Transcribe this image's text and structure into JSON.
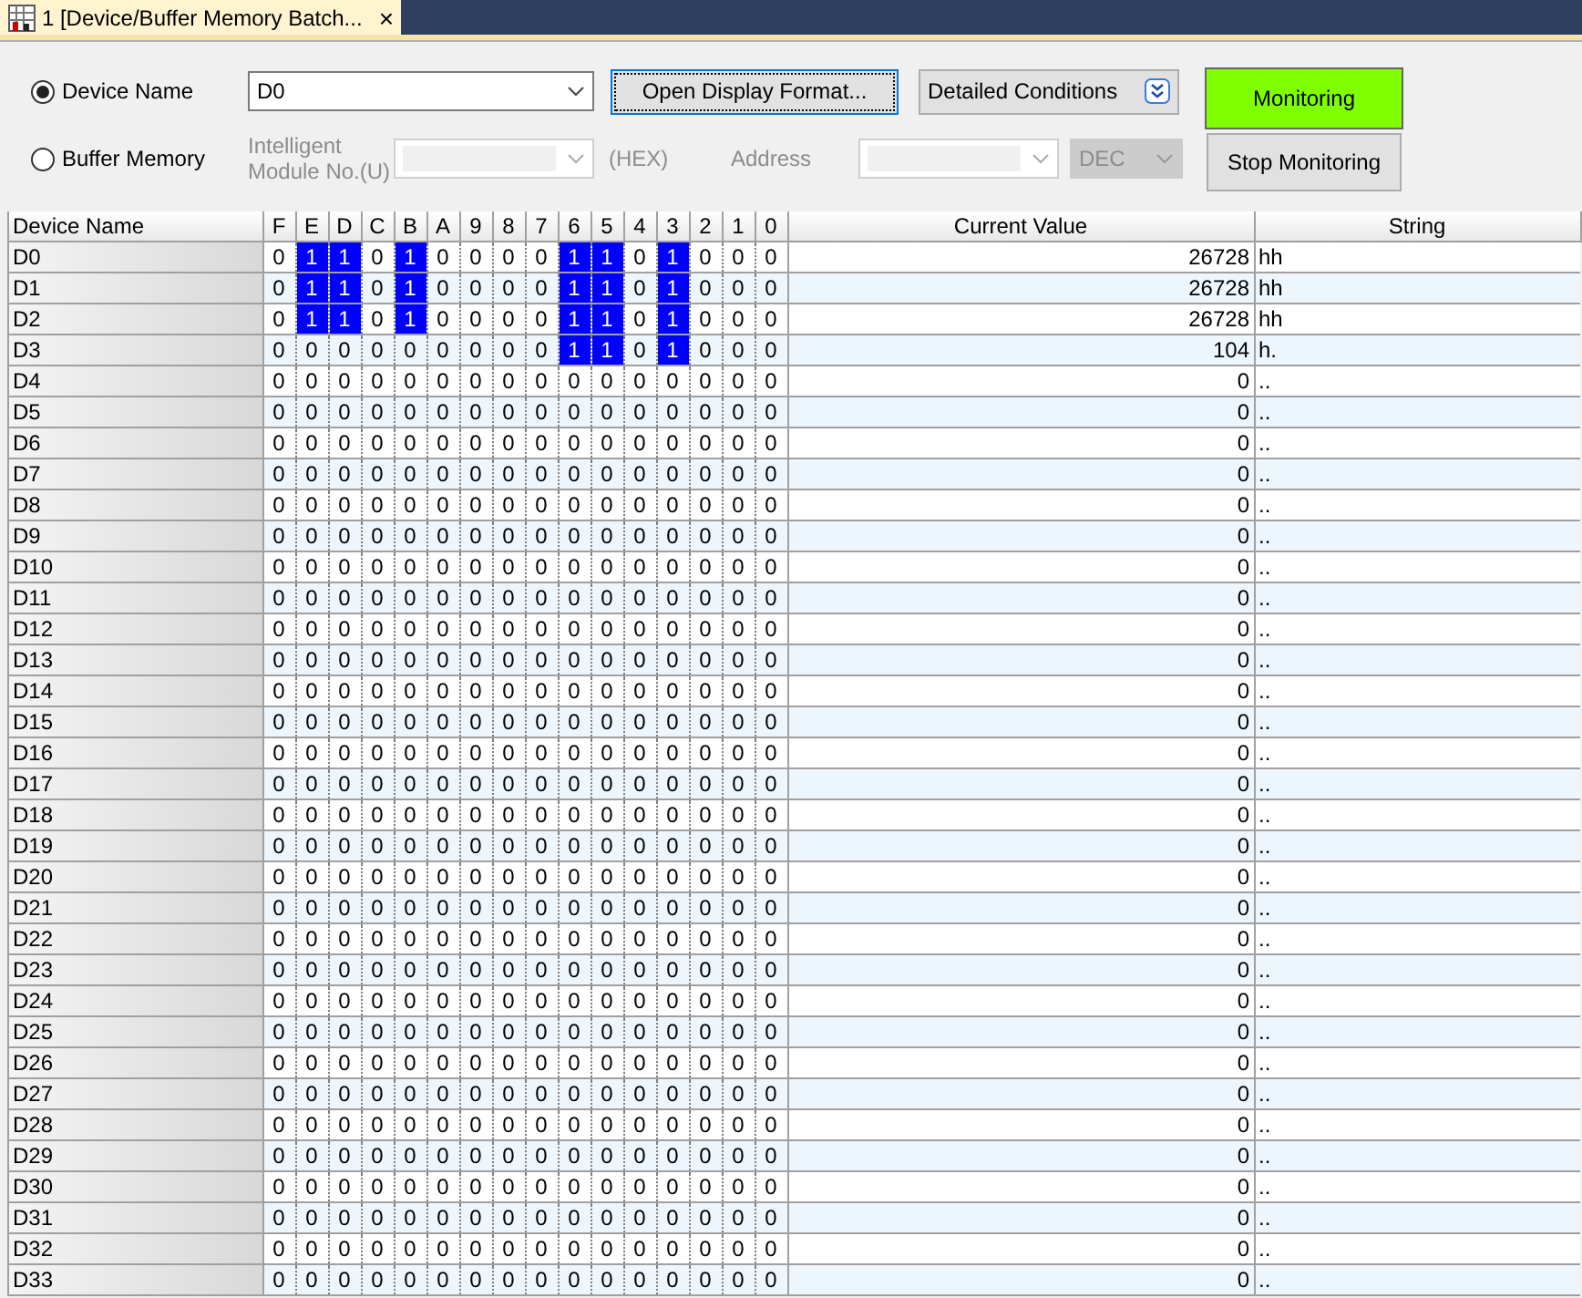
{
  "tab": {
    "title": "1 [Device/Buffer Memory Batch...",
    "close": "×"
  },
  "mode": [
    {
      "label": "Device Name",
      "selected": true
    },
    {
      "label": "Buffer Memory",
      "selected": false
    }
  ],
  "device_field": {
    "value": "D0"
  },
  "open_format_button": "Open Display Format...",
  "detailed_conditions": "Detailed Conditions",
  "monitoring_button": {
    "label": "Monitoring",
    "on": true
  },
  "stop_button": "Stop Monitoring",
  "module_label": "Intelligent Module No.(U)",
  "module_unit": "(HEX)",
  "address_label": "Address",
  "address_format": "DEC",
  "table": {
    "name_header": "Device Name",
    "bit_headers": [
      "F",
      "E",
      "D",
      "C",
      "B",
      "A",
      "9",
      "8",
      "7",
      "6",
      "5",
      "4",
      "3",
      "2",
      "1",
      "0"
    ],
    "value_header": "Current Value",
    "string_header": "String",
    "rows": [
      {
        "name": "D0",
        "bits": [
          "0",
          "1",
          "1",
          "0",
          "1",
          "0",
          "0",
          "0",
          "0",
          "1",
          "1",
          "0",
          "1",
          "0",
          "0",
          "0"
        ],
        "set": [
          false,
          true,
          true,
          false,
          true,
          false,
          false,
          false,
          false,
          true,
          true,
          false,
          true,
          false,
          false,
          false
        ],
        "value": "26728",
        "string": "hh"
      },
      {
        "name": "D1",
        "bits": [
          "0",
          "1",
          "1",
          "0",
          "1",
          "0",
          "0",
          "0",
          "0",
          "1",
          "1",
          "0",
          "1",
          "0",
          "0",
          "0"
        ],
        "set": [
          false,
          true,
          true,
          false,
          true,
          false,
          false,
          false,
          false,
          true,
          true,
          false,
          true,
          false,
          false,
          false
        ],
        "value": "26728",
        "string": "hh"
      },
      {
        "name": "D2",
        "bits": [
          "0",
          "1",
          "1",
          "0",
          "1",
          "0",
          "0",
          "0",
          "0",
          "1",
          "1",
          "0",
          "1",
          "0",
          "0",
          "0"
        ],
        "set": [
          false,
          true,
          true,
          false,
          true,
          false,
          false,
          false,
          false,
          true,
          true,
          false,
          true,
          false,
          false,
          false
        ],
        "value": "26728",
        "string": "hh"
      },
      {
        "name": "D3",
        "bits": [
          "0",
          "0",
          "0",
          "0",
          "0",
          "0",
          "0",
          "0",
          "0",
          "1",
          "1",
          "0",
          "1",
          "0",
          "0",
          "0"
        ],
        "set": [
          false,
          false,
          false,
          false,
          false,
          false,
          false,
          false,
          false,
          true,
          true,
          false,
          true,
          false,
          false,
          false
        ],
        "value": "104",
        "string": "h."
      },
      {
        "name": "D4",
        "bits": [
          "0",
          "0",
          "0",
          "0",
          "0",
          "0",
          "0",
          "0",
          "0",
          "0",
          "0",
          "0",
          "0",
          "0",
          "0",
          "0"
        ],
        "set": [
          false,
          false,
          false,
          false,
          false,
          false,
          false,
          false,
          false,
          false,
          false,
          false,
          false,
          false,
          false,
          false
        ],
        "value": "0",
        "string": ".."
      },
      {
        "name": "D5",
        "bits": [
          "0",
          "0",
          "0",
          "0",
          "0",
          "0",
          "0",
          "0",
          "0",
          "0",
          "0",
          "0",
          "0",
          "0",
          "0",
          "0"
        ],
        "set": [
          false,
          false,
          false,
          false,
          false,
          false,
          false,
          false,
          false,
          false,
          false,
          false,
          false,
          false,
          false,
          false
        ],
        "value": "0",
        "string": ".."
      },
      {
        "name": "D6",
        "bits": [
          "0",
          "0",
          "0",
          "0",
          "0",
          "0",
          "0",
          "0",
          "0",
          "0",
          "0",
          "0",
          "0",
          "0",
          "0",
          "0"
        ],
        "set": [
          false,
          false,
          false,
          false,
          false,
          false,
          false,
          false,
          false,
          false,
          false,
          false,
          false,
          false,
          false,
          false
        ],
        "value": "0",
        "string": ".."
      },
      {
        "name": "D7",
        "bits": [
          "0",
          "0",
          "0",
          "0",
          "0",
          "0",
          "0",
          "0",
          "0",
          "0",
          "0",
          "0",
          "0",
          "0",
          "0",
          "0"
        ],
        "set": [
          false,
          false,
          false,
          false,
          false,
          false,
          false,
          false,
          false,
          false,
          false,
          false,
          false,
          false,
          false,
          false
        ],
        "value": "0",
        "string": ".."
      },
      {
        "name": "D8",
        "bits": [
          "0",
          "0",
          "0",
          "0",
          "0",
          "0",
          "0",
          "0",
          "0",
          "0",
          "0",
          "0",
          "0",
          "0",
          "0",
          "0"
        ],
        "set": [
          false,
          false,
          false,
          false,
          false,
          false,
          false,
          false,
          false,
          false,
          false,
          false,
          false,
          false,
          false,
          false
        ],
        "value": "0",
        "string": ".."
      },
      {
        "name": "D9",
        "bits": [
          "0",
          "0",
          "0",
          "0",
          "0",
          "0",
          "0",
          "0",
          "0",
          "0",
          "0",
          "0",
          "0",
          "0",
          "0",
          "0"
        ],
        "set": [
          false,
          false,
          false,
          false,
          false,
          false,
          false,
          false,
          false,
          false,
          false,
          false,
          false,
          false,
          false,
          false
        ],
        "value": "0",
        "string": ".."
      },
      {
        "name": "D10",
        "bits": [
          "0",
          "0",
          "0",
          "0",
          "0",
          "0",
          "0",
          "0",
          "0",
          "0",
          "0",
          "0",
          "0",
          "0",
          "0",
          "0"
        ],
        "set": [
          false,
          false,
          false,
          false,
          false,
          false,
          false,
          false,
          false,
          false,
          false,
          false,
          false,
          false,
          false,
          false
        ],
        "value": "0",
        "string": ".."
      },
      {
        "name": "D11",
        "bits": [
          "0",
          "0",
          "0",
          "0",
          "0",
          "0",
          "0",
          "0",
          "0",
          "0",
          "0",
          "0",
          "0",
          "0",
          "0",
          "0"
        ],
        "set": [
          false,
          false,
          false,
          false,
          false,
          false,
          false,
          false,
          false,
          false,
          false,
          false,
          false,
          false,
          false,
          false
        ],
        "value": "0",
        "string": ".."
      },
      {
        "name": "D12",
        "bits": [
          "0",
          "0",
          "0",
          "0",
          "0",
          "0",
          "0",
          "0",
          "0",
          "0",
          "0",
          "0",
          "0",
          "0",
          "0",
          "0"
        ],
        "set": [
          false,
          false,
          false,
          false,
          false,
          false,
          false,
          false,
          false,
          false,
          false,
          false,
          false,
          false,
          false,
          false
        ],
        "value": "0",
        "string": ".."
      },
      {
        "name": "D13",
        "bits": [
          "0",
          "0",
          "0",
          "0",
          "0",
          "0",
          "0",
          "0",
          "0",
          "0",
          "0",
          "0",
          "0",
          "0",
          "0",
          "0"
        ],
        "set": [
          false,
          false,
          false,
          false,
          false,
          false,
          false,
          false,
          false,
          false,
          false,
          false,
          false,
          false,
          false,
          false
        ],
        "value": "0",
        "string": ".."
      },
      {
        "name": "D14",
        "bits": [
          "0",
          "0",
          "0",
          "0",
          "0",
          "0",
          "0",
          "0",
          "0",
          "0",
          "0",
          "0",
          "0",
          "0",
          "0",
          "0"
        ],
        "set": [
          false,
          false,
          false,
          false,
          false,
          false,
          false,
          false,
          false,
          false,
          false,
          false,
          false,
          false,
          false,
          false
        ],
        "value": "0",
        "string": ".."
      },
      {
        "name": "D15",
        "bits": [
          "0",
          "0",
          "0",
          "0",
          "0",
          "0",
          "0",
          "0",
          "0",
          "0",
          "0",
          "0",
          "0",
          "0",
          "0",
          "0"
        ],
        "set": [
          false,
          false,
          false,
          false,
          false,
          false,
          false,
          false,
          false,
          false,
          false,
          false,
          false,
          false,
          false,
          false
        ],
        "value": "0",
        "string": ".."
      },
      {
        "name": "D16",
        "bits": [
          "0",
          "0",
          "0",
          "0",
          "0",
          "0",
          "0",
          "0",
          "0",
          "0",
          "0",
          "0",
          "0",
          "0",
          "0",
          "0"
        ],
        "set": [
          false,
          false,
          false,
          false,
          false,
          false,
          false,
          false,
          false,
          false,
          false,
          false,
          false,
          false,
          false,
          false
        ],
        "value": "0",
        "string": ".."
      },
      {
        "name": "D17",
        "bits": [
          "0",
          "0",
          "0",
          "0",
          "0",
          "0",
          "0",
          "0",
          "0",
          "0",
          "0",
          "0",
          "0",
          "0",
          "0",
          "0"
        ],
        "set": [
          false,
          false,
          false,
          false,
          false,
          false,
          false,
          false,
          false,
          false,
          false,
          false,
          false,
          false,
          false,
          false
        ],
        "value": "0",
        "string": ".."
      },
      {
        "name": "D18",
        "bits": [
          "0",
          "0",
          "0",
          "0",
          "0",
          "0",
          "0",
          "0",
          "0",
          "0",
          "0",
          "0",
          "0",
          "0",
          "0",
          "0"
        ],
        "set": [
          false,
          false,
          false,
          false,
          false,
          false,
          false,
          false,
          false,
          false,
          false,
          false,
          false,
          false,
          false,
          false
        ],
        "value": "0",
        "string": ".."
      },
      {
        "name": "D19",
        "bits": [
          "0",
          "0",
          "0",
          "0",
          "0",
          "0",
          "0",
          "0",
          "0",
          "0",
          "0",
          "0",
          "0",
          "0",
          "0",
          "0"
        ],
        "set": [
          false,
          false,
          false,
          false,
          false,
          false,
          false,
          false,
          false,
          false,
          false,
          false,
          false,
          false,
          false,
          false
        ],
        "value": "0",
        "string": ".."
      },
      {
        "name": "D20",
        "bits": [
          "0",
          "0",
          "0",
          "0",
          "0",
          "0",
          "0",
          "0",
          "0",
          "0",
          "0",
          "0",
          "0",
          "0",
          "0",
          "0"
        ],
        "set": [
          false,
          false,
          false,
          false,
          false,
          false,
          false,
          false,
          false,
          false,
          false,
          false,
          false,
          false,
          false,
          false
        ],
        "value": "0",
        "string": ".."
      },
      {
        "name": "D21",
        "bits": [
          "0",
          "0",
          "0",
          "0",
          "0",
          "0",
          "0",
          "0",
          "0",
          "0",
          "0",
          "0",
          "0",
          "0",
          "0",
          "0"
        ],
        "set": [
          false,
          false,
          false,
          false,
          false,
          false,
          false,
          false,
          false,
          false,
          false,
          false,
          false,
          false,
          false,
          false
        ],
        "value": "0",
        "string": ".."
      },
      {
        "name": "D22",
        "bits": [
          "0",
          "0",
          "0",
          "0",
          "0",
          "0",
          "0",
          "0",
          "0",
          "0",
          "0",
          "0",
          "0",
          "0",
          "0",
          "0"
        ],
        "set": [
          false,
          false,
          false,
          false,
          false,
          false,
          false,
          false,
          false,
          false,
          false,
          false,
          false,
          false,
          false,
          false
        ],
        "value": "0",
        "string": ".."
      },
      {
        "name": "D23",
        "bits": [
          "0",
          "0",
          "0",
          "0",
          "0",
          "0",
          "0",
          "0",
          "0",
          "0",
          "0",
          "0",
          "0",
          "0",
          "0",
          "0"
        ],
        "set": [
          false,
          false,
          false,
          false,
          false,
          false,
          false,
          false,
          false,
          false,
          false,
          false,
          false,
          false,
          false,
          false
        ],
        "value": "0",
        "string": ".."
      },
      {
        "name": "D24",
        "bits": [
          "0",
          "0",
          "0",
          "0",
          "0",
          "0",
          "0",
          "0",
          "0",
          "0",
          "0",
          "0",
          "0",
          "0",
          "0",
          "0"
        ],
        "set": [
          false,
          false,
          false,
          false,
          false,
          false,
          false,
          false,
          false,
          false,
          false,
          false,
          false,
          false,
          false,
          false
        ],
        "value": "0",
        "string": ".."
      },
      {
        "name": "D25",
        "bits": [
          "0",
          "0",
          "0",
          "0",
          "0",
          "0",
          "0",
          "0",
          "0",
          "0",
          "0",
          "0",
          "0",
          "0",
          "0",
          "0"
        ],
        "set": [
          false,
          false,
          false,
          false,
          false,
          false,
          false,
          false,
          false,
          false,
          false,
          false,
          false,
          false,
          false,
          false
        ],
        "value": "0",
        "string": ".."
      },
      {
        "name": "D26",
        "bits": [
          "0",
          "0",
          "0",
          "0",
          "0",
          "0",
          "0",
          "0",
          "0",
          "0",
          "0",
          "0",
          "0",
          "0",
          "0",
          "0"
        ],
        "set": [
          false,
          false,
          false,
          false,
          false,
          false,
          false,
          false,
          false,
          false,
          false,
          false,
          false,
          false,
          false,
          false
        ],
        "value": "0",
        "string": ".."
      },
      {
        "name": "D27",
        "bits": [
          "0",
          "0",
          "0",
          "0",
          "0",
          "0",
          "0",
          "0",
          "0",
          "0",
          "0",
          "0",
          "0",
          "0",
          "0",
          "0"
        ],
        "set": [
          false,
          false,
          false,
          false,
          false,
          false,
          false,
          false,
          false,
          false,
          false,
          false,
          false,
          false,
          false,
          false
        ],
        "value": "0",
        "string": ".."
      },
      {
        "name": "D28",
        "bits": [
          "0",
          "0",
          "0",
          "0",
          "0",
          "0",
          "0",
          "0",
          "0",
          "0",
          "0",
          "0",
          "0",
          "0",
          "0",
          "0"
        ],
        "set": [
          false,
          false,
          false,
          false,
          false,
          false,
          false,
          false,
          false,
          false,
          false,
          false,
          false,
          false,
          false,
          false
        ],
        "value": "0",
        "string": ".."
      },
      {
        "name": "D29",
        "bits": [
          "0",
          "0",
          "0",
          "0",
          "0",
          "0",
          "0",
          "0",
          "0",
          "0",
          "0",
          "0",
          "0",
          "0",
          "0",
          "0"
        ],
        "set": [
          false,
          false,
          false,
          false,
          false,
          false,
          false,
          false,
          false,
          false,
          false,
          false,
          false,
          false,
          false,
          false
        ],
        "value": "0",
        "string": ".."
      },
      {
        "name": "D30",
        "bits": [
          "0",
          "0",
          "0",
          "0",
          "0",
          "0",
          "0",
          "0",
          "0",
          "0",
          "0",
          "0",
          "0",
          "0",
          "0",
          "0"
        ],
        "set": [
          false,
          false,
          false,
          false,
          false,
          false,
          false,
          false,
          false,
          false,
          false,
          false,
          false,
          false,
          false,
          false
        ],
        "value": "0",
        "string": ".."
      },
      {
        "name": "D31",
        "bits": [
          "0",
          "0",
          "0",
          "0",
          "0",
          "0",
          "0",
          "0",
          "0",
          "0",
          "0",
          "0",
          "0",
          "0",
          "0",
          "0"
        ],
        "set": [
          false,
          false,
          false,
          false,
          false,
          false,
          false,
          false,
          false,
          false,
          false,
          false,
          false,
          false,
          false,
          false
        ],
        "value": "0",
        "string": ".."
      },
      {
        "name": "D32",
        "bits": [
          "0",
          "0",
          "0",
          "0",
          "0",
          "0",
          "0",
          "0",
          "0",
          "0",
          "0",
          "0",
          "0",
          "0",
          "0",
          "0"
        ],
        "set": [
          false,
          false,
          false,
          false,
          false,
          false,
          false,
          false,
          false,
          false,
          false,
          false,
          false,
          false,
          false,
          false
        ],
        "value": "0",
        "string": ".."
      },
      {
        "name": "D33",
        "bits": [
          "0",
          "0",
          "0",
          "0",
          "0",
          "0",
          "0",
          "0",
          "0",
          "0",
          "0",
          "0",
          "0",
          "0",
          "0",
          "0"
        ],
        "set": [
          false,
          false,
          false,
          false,
          false,
          false,
          false,
          false,
          false,
          false,
          false,
          false,
          false,
          false,
          false,
          false
        ],
        "value": "0",
        "string": ".."
      }
    ]
  }
}
